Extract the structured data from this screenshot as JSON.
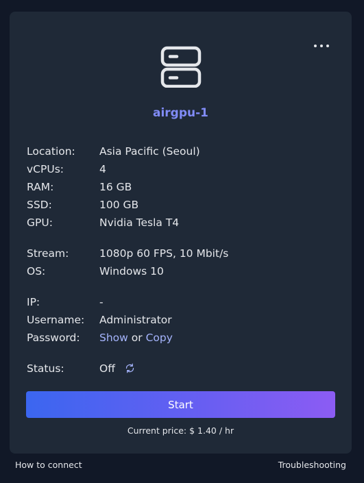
{
  "server": {
    "name": "airgpu-1"
  },
  "details": {
    "location": {
      "label": "Location:",
      "value": "Asia Pacific (Seoul)"
    },
    "vcpus": {
      "label": "vCPUs:",
      "value": "4"
    },
    "ram": {
      "label": "RAM:",
      "value": "16 GB"
    },
    "ssd": {
      "label": "SSD:",
      "value": "100 GB"
    },
    "gpu": {
      "label": "GPU:",
      "value": "Nvidia Tesla T4"
    },
    "stream": {
      "label": "Stream:",
      "value": "1080p 60 FPS, 10 Mbit/s"
    },
    "os": {
      "label": "OS:",
      "value": "Windows 10"
    },
    "ip": {
      "label": "IP:",
      "value": "-"
    },
    "username": {
      "label": "Username:",
      "value": "Administrator"
    },
    "password": {
      "label": "Password:",
      "show_link": "Show",
      "or_text": "or",
      "copy_link": "Copy"
    },
    "status": {
      "label": "Status:",
      "value": "Off"
    }
  },
  "actions": {
    "start_label": "Start",
    "price_text": "Current price: $ 1.40 / hr"
  },
  "footer": {
    "how_to_connect": "How to connect",
    "troubleshooting": "Troubleshooting"
  },
  "icons": {
    "more": "more-horizontal-icon",
    "server": "server-icon",
    "refresh": "refresh-icon"
  },
  "colors": {
    "background": "#111827",
    "card": "#1f2937",
    "accent": "#818cf8",
    "link": "#a5b4fc",
    "button_gradient_start": "#3b66f0",
    "button_gradient_end": "#8c5cf3"
  }
}
